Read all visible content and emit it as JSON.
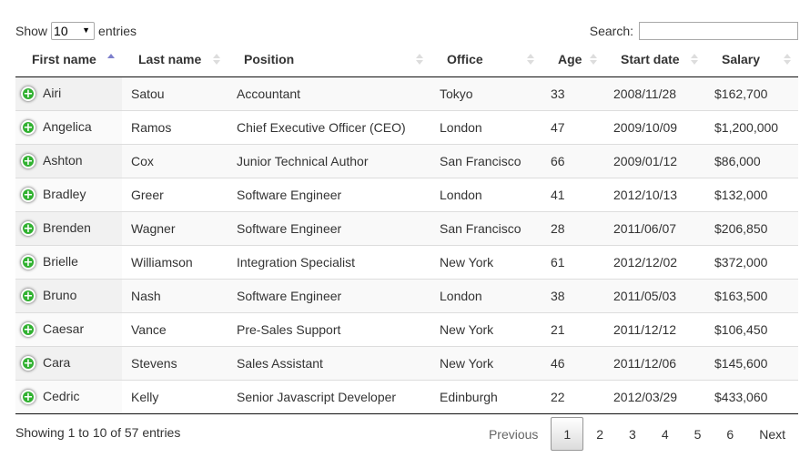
{
  "length_menu": {
    "show_label": "Show",
    "selected": "10",
    "entries_label": "entries"
  },
  "search": {
    "label": "Search:",
    "value": "",
    "placeholder": ""
  },
  "columns": [
    {
      "label": "First name",
      "sort": "asc"
    },
    {
      "label": "Last name",
      "sort": "none"
    },
    {
      "label": "Position",
      "sort": "none"
    },
    {
      "label": "Office",
      "sort": "none"
    },
    {
      "label": "Age",
      "sort": "none"
    },
    {
      "label": "Start date",
      "sort": "none"
    },
    {
      "label": "Salary",
      "sort": "none"
    }
  ],
  "rows": [
    {
      "first": "Airi",
      "last": "Satou",
      "position": "Accountant",
      "office": "Tokyo",
      "age": "33",
      "start": "2008/11/28",
      "salary": "$162,700"
    },
    {
      "first": "Angelica",
      "last": "Ramos",
      "position": "Chief Executive Officer (CEO)",
      "office": "London",
      "age": "47",
      "start": "2009/10/09",
      "salary": "$1,200,000"
    },
    {
      "first": "Ashton",
      "last": "Cox",
      "position": "Junior Technical Author",
      "office": "San Francisco",
      "age": "66",
      "start": "2009/01/12",
      "salary": "$86,000"
    },
    {
      "first": "Bradley",
      "last": "Greer",
      "position": "Software Engineer",
      "office": "London",
      "age": "41",
      "start": "2012/10/13",
      "salary": "$132,000"
    },
    {
      "first": "Brenden",
      "last": "Wagner",
      "position": "Software Engineer",
      "office": "San Francisco",
      "age": "28",
      "start": "2011/06/07",
      "salary": "$206,850"
    },
    {
      "first": "Brielle",
      "last": "Williamson",
      "position": "Integration Specialist",
      "office": "New York",
      "age": "61",
      "start": "2012/12/02",
      "salary": "$372,000"
    },
    {
      "first": "Bruno",
      "last": "Nash",
      "position": "Software Engineer",
      "office": "London",
      "age": "38",
      "start": "2011/05/03",
      "salary": "$163,500"
    },
    {
      "first": "Caesar",
      "last": "Vance",
      "position": "Pre-Sales Support",
      "office": "New York",
      "age": "21",
      "start": "2011/12/12",
      "salary": "$106,450"
    },
    {
      "first": "Cara",
      "last": "Stevens",
      "position": "Sales Assistant",
      "office": "New York",
      "age": "46",
      "start": "2011/12/06",
      "salary": "$145,600"
    },
    {
      "first": "Cedric",
      "last": "Kelly",
      "position": "Senior Javascript Developer",
      "office": "Edinburgh",
      "age": "22",
      "start": "2012/03/29",
      "salary": "$433,060"
    }
  ],
  "row_icon": "plus-circle-icon",
  "info": "Showing 1 to 10 of 57 entries",
  "pagination": {
    "previous": "Previous",
    "next": "Next",
    "pages": [
      "1",
      "2",
      "3",
      "4",
      "5",
      "6"
    ],
    "current": "1"
  },
  "colors": {
    "expand_icon": "#31b131",
    "sort_active": "#7d7fcc"
  }
}
